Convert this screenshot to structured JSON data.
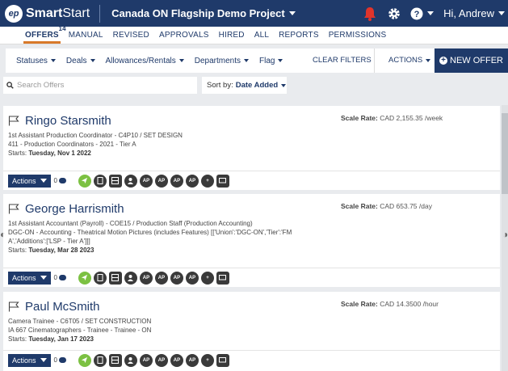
{
  "header": {
    "logo_mark": "ep",
    "brand_bold": "Smart",
    "brand_rest": "Start",
    "project": "Canada ON Flagship Demo Project",
    "greeting": "Hi, Andrew"
  },
  "tabs": [
    {
      "label": "OFFERS",
      "count": "14",
      "active": true
    },
    {
      "label": "MANUAL"
    },
    {
      "label": "REVISED"
    },
    {
      "label": "APPROVALS"
    },
    {
      "label": "HIRED"
    },
    {
      "label": "ALL"
    },
    {
      "label": "REPORTS"
    },
    {
      "label": "PERMISSIONS"
    }
  ],
  "filters": {
    "items": [
      "Statuses",
      "Deals",
      "Allowances/Rentals",
      "Departments",
      "Flag"
    ],
    "clear": "CLEAR FILTERS",
    "actions": "ACTIONS",
    "new_offer": "NEW OFFER"
  },
  "search": {
    "placeholder": "Search Offers"
  },
  "sort": {
    "label": "Sort by:",
    "value": "Date Added"
  },
  "offers": [
    {
      "name": "Ringo Starsmith",
      "rate_label": "Scale Rate:",
      "rate_value": "CAD 2,155.35 /week",
      "line1": "1st Assistant Production Coordinator - C4P10 / SET DESIGN",
      "line2": "411 - Production Coordinators - 2021 - Tier A",
      "line3": "",
      "starts_label": "Starts:",
      "starts_value": "Tuesday, Nov 1 2022",
      "actions_label": "Actions",
      "comments": "0"
    },
    {
      "name": "George Harrismith",
      "rate_label": "Scale Rate:",
      "rate_value": "CAD 653.75 /day",
      "line1": "1st Assistant Accountant (Payroll) - COE15 / Production Staff (Production Accounting)",
      "line2": "DGC-ON - Accounting - Theatrical Motion Pictures (includes Features) [['Union':'DGC-ON','Tier':'FM",
      "line3": "A','Additions':['LSP - Tier A']]]",
      "starts_label": "Starts:",
      "starts_value": "Tuesday, Mar 28 2023",
      "actions_label": "Actions",
      "comments": "0"
    },
    {
      "name": "Paul McSmith",
      "rate_label": "Scale Rate:",
      "rate_value": "CAD 14.3500 /hour",
      "line1": "Camera Trainee - C6T05 / SET CONSTRUCTION",
      "line2": "IA 667 Cinematographers - Trainee - Trainee - ON",
      "line3": "",
      "starts_label": "Starts:",
      "starts_value": "Tuesday, Jan 17 2023",
      "actions_label": "Actions",
      "comments": "0"
    }
  ],
  "icon_labels": {
    "ap": "AP",
    "plus_dots": "+"
  },
  "colors": {
    "nav": "#1f3a6a",
    "accent": "#d8792a",
    "green": "#7cc142"
  }
}
